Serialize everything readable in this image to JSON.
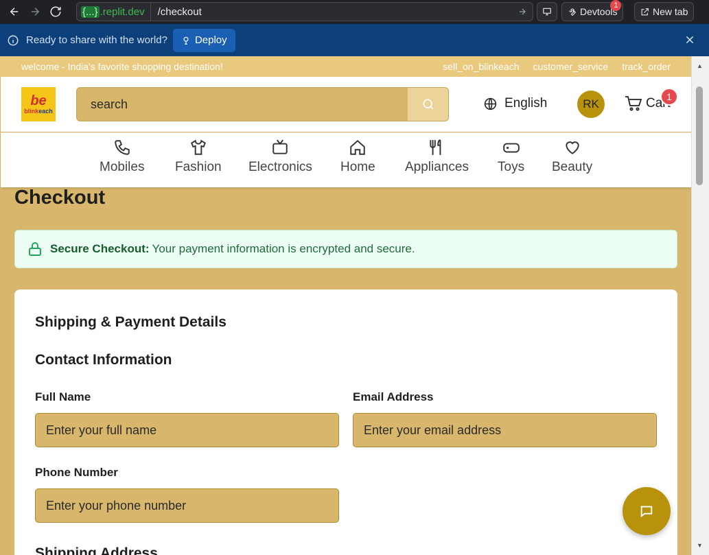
{
  "browser": {
    "url_domain_placeholder": "{...}",
    "url_domain_suffix": ".replit.dev",
    "url_path": "/checkout",
    "devtools_label": "Devtools",
    "devtools_badge": "1",
    "newtab_label": "New tab"
  },
  "deploy_banner": {
    "text": "Ready to share with the world?",
    "button_label": "Deploy"
  },
  "promo": {
    "welcome": "welcome - India's favorite shopping destination!",
    "links": [
      "sell_on_blinkeach",
      "customer_service",
      "track_order"
    ]
  },
  "header": {
    "logo_mark": "be",
    "logo_text_a": "blink",
    "logo_text_b": "each",
    "search_placeholder": "search",
    "language": "English",
    "avatar_initials": "RK",
    "cart_label": "Cart",
    "cart_count": "1"
  },
  "categories": [
    {
      "label": "Mobiles",
      "icon": "phone-icon"
    },
    {
      "label": "Fashion",
      "icon": "shirt-icon"
    },
    {
      "label": "Electronics",
      "icon": "tv-icon"
    },
    {
      "label": "Home",
      "icon": "house-icon"
    },
    {
      "label": "Appliances",
      "icon": "utensils-icon"
    },
    {
      "label": "Toys",
      "icon": "gamepad-icon"
    },
    {
      "label": "Beauty",
      "icon": "heart-icon"
    }
  ],
  "checkout": {
    "title": "Checkout",
    "secure_label": "Secure Checkout:",
    "secure_text": "Your payment information is encrypted and secure.",
    "section_title": "Shipping & Payment Details",
    "contact_title": "Contact Information",
    "fields": {
      "full_name_label": "Full Name",
      "full_name_placeholder": "Enter your full name",
      "email_label": "Email Address",
      "email_placeholder": "Enter your email address",
      "phone_label": "Phone Number",
      "phone_placeholder": "Enter your phone number"
    },
    "shipping_title": "Shipping Address"
  },
  "colors": {
    "gold": "#d8b76c",
    "promo": "#e8c97e",
    "accent": "#b8920a",
    "deploy_bar": "#0d3f7a",
    "secure_bg": "#ecfdf3"
  }
}
